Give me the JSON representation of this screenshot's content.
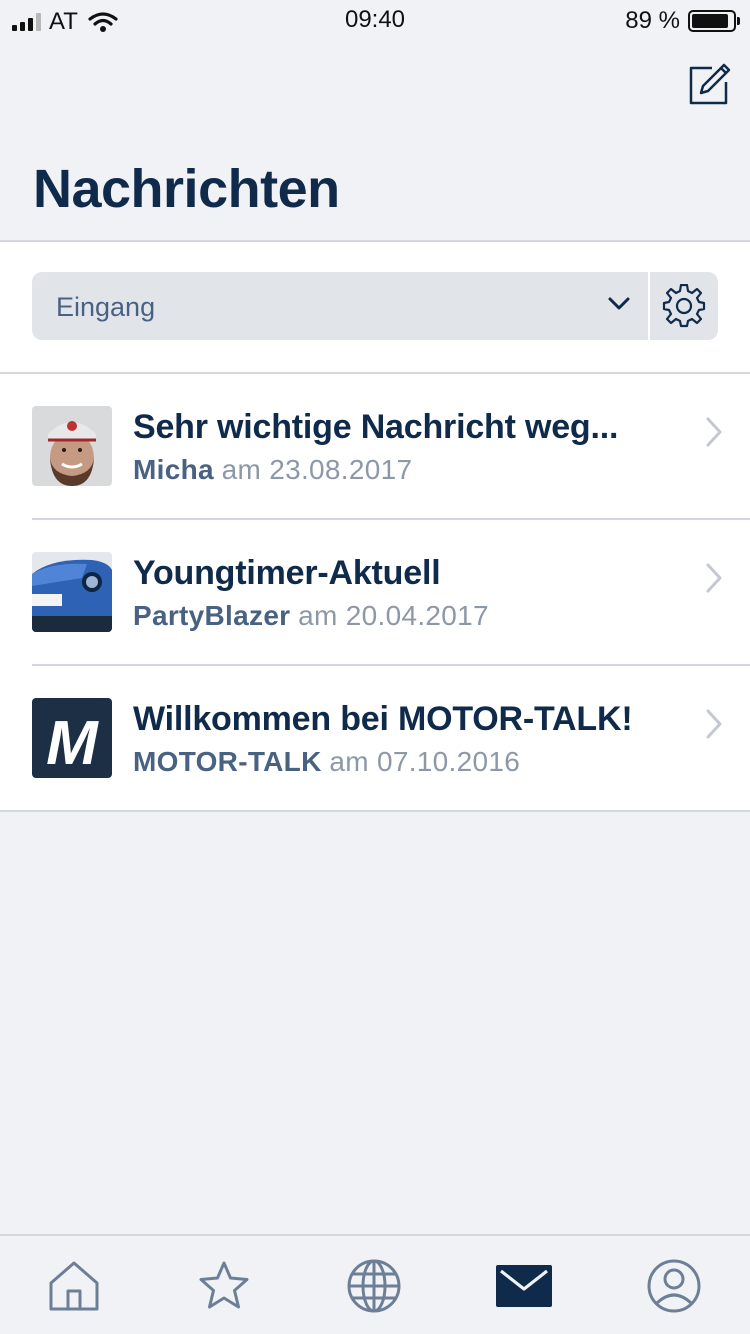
{
  "status_bar": {
    "carrier": "AT",
    "time": "09:40",
    "battery": "89 %"
  },
  "header": {
    "title": "Nachrichten",
    "compose_icon": "compose-icon"
  },
  "filter": {
    "selected": "Eingang",
    "settings_icon": "gear-icon"
  },
  "messages": [
    {
      "title": "Sehr wichtige Nachricht weg...",
      "sender": "Micha",
      "date": "am 23.08.2017",
      "avatar": "person-avatar"
    },
    {
      "title": "Youngtimer-Aktuell",
      "sender": "PartyBlazer",
      "date": "am 20.04.2017",
      "avatar": "blue-car-avatar"
    },
    {
      "title": "Willkommen bei MOTOR-TALK!",
      "sender": "MOTOR-TALK",
      "date": "am 07.10.2016",
      "avatar": "motor-talk-logo",
      "avatar_letter": "M"
    }
  ],
  "tab_bar": {
    "tabs": [
      {
        "icon": "home-icon",
        "active": false
      },
      {
        "icon": "star-icon",
        "active": false
      },
      {
        "icon": "globe-icon",
        "active": false
      },
      {
        "icon": "mail-icon",
        "active": true
      },
      {
        "icon": "profile-icon",
        "active": false
      }
    ]
  },
  "colors": {
    "primary": "#0f2a4a",
    "secondary": "#4a6282",
    "muted": "#8d98a7",
    "background": "#f1f2f6",
    "select_bg": "#e1e5ea"
  }
}
